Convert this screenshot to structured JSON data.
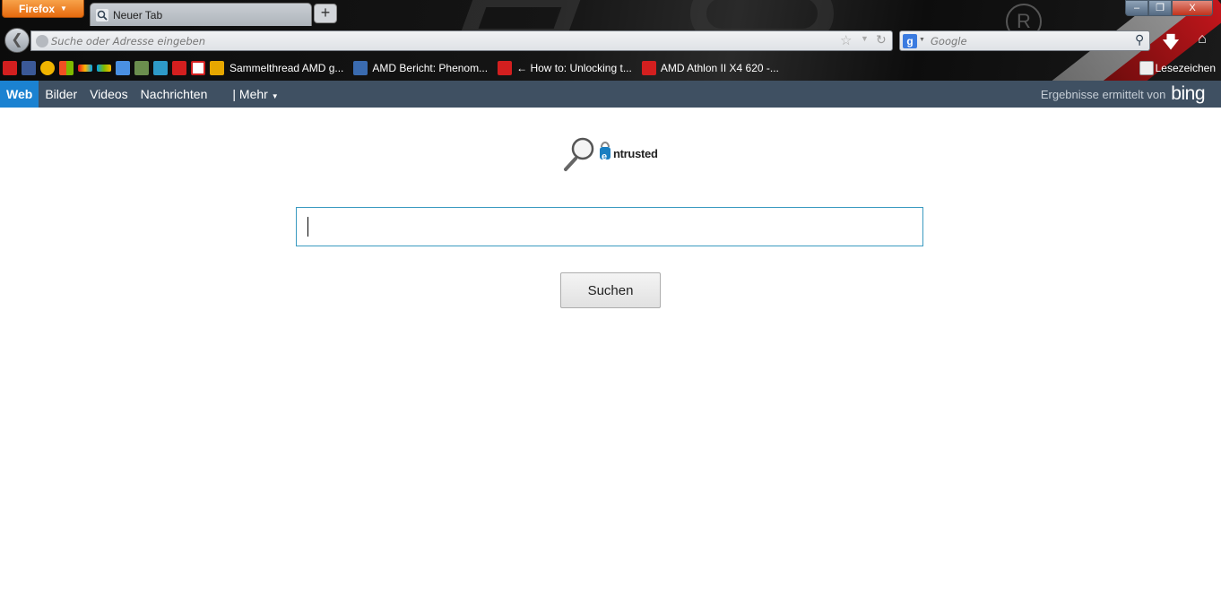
{
  "browser": {
    "app_button": "Firefox",
    "tab_title": "Neuer Tab",
    "new_tab": "+",
    "url_placeholder": "Suche oder Adresse eingeben",
    "search_engine_placeholder": "Google",
    "search_engine_icon_letter": "g",
    "window_controls": {
      "minimize": "–",
      "maximize": "❐",
      "close": "X"
    }
  },
  "bookmarks": {
    "icons": [
      "youtube-icon",
      "facebook-icon",
      "site-icon",
      "windows-icon",
      "tiles-icon",
      "tiles-icon",
      "translate-icon",
      "photo-icon",
      "iq-icon",
      "square-icon",
      "cb-icon",
      "chart-icon"
    ],
    "items": [
      {
        "label": "Sammelthread AMD g...",
        "icon": "bar-chart-icon"
      },
      {
        "label": "AMD Bericht: Phenom...",
        "icon": "document-icon"
      },
      {
        "label": "← How to: Unlocking t...",
        "icon": "youtube-icon"
      },
      {
        "label": "AMD Athlon II X4 620 -...",
        "icon": "h-site-icon"
      }
    ],
    "right_label": "Lesezeichen"
  },
  "bing_nav": {
    "links": [
      "Web",
      "Bilder",
      "Videos",
      "Nachrichten"
    ],
    "more": "| Mehr",
    "credit": "Ergebnisse ermittelt von",
    "credit_brand": "bing"
  },
  "main": {
    "logo_text": "ntrusted",
    "logo_letter": "e",
    "search_value": "",
    "search_button": "Suchen"
  },
  "colors": {
    "bing_nav_bg": "#3f5062",
    "active_tab": "#1b82d1",
    "firefox_orange": "#e66a0e",
    "search_border": "#3a9ac0"
  }
}
